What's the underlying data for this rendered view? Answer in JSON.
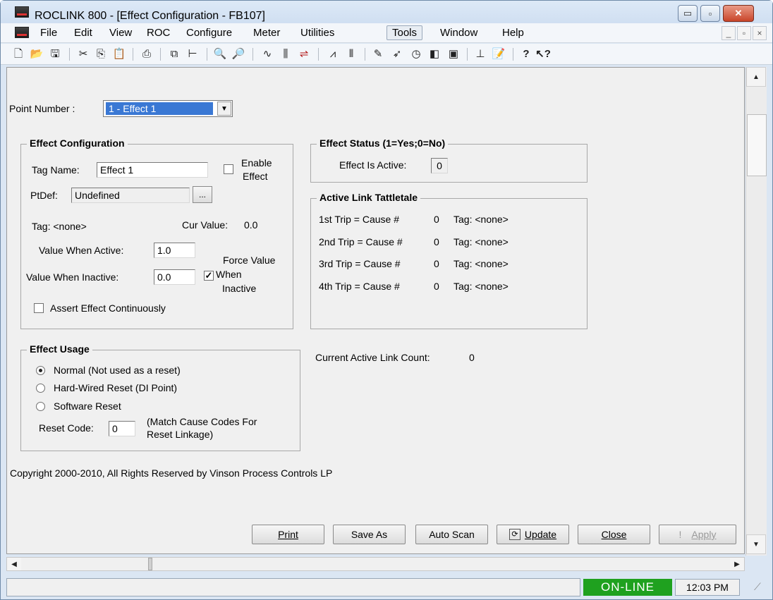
{
  "window": {
    "title": "ROCLINK 800 - [Effect Configuration - FB107]",
    "controls": {
      "minimize": "▭",
      "maximize": "▫",
      "close": "✕"
    }
  },
  "menu": {
    "items": [
      "File",
      "Edit",
      "View",
      "ROC",
      "Configure",
      "Meter",
      "Utilities",
      "Tools",
      "Window",
      "Help"
    ],
    "active": "Tools",
    "mdi_controls": [
      "_",
      "▫",
      "×"
    ]
  },
  "toolbar": {
    "icons": [
      "new-icon",
      "open-icon",
      "save-icon",
      "cut-icon",
      "copy-icon",
      "paste-icon",
      "print-icon",
      "connect-icon",
      "tree-icon",
      "zoom-in-icon",
      "zoom-out-icon",
      "trend-icon",
      "bars-icon",
      "link-icon",
      "wave-icon",
      "signal-icon",
      "flash-icon",
      "direct-icon",
      "clock-icon",
      "display-icon",
      "display2-icon",
      "chart-icon",
      "report-icon",
      "help-icon",
      "context-help-icon"
    ]
  },
  "form": {
    "point_number_label": "Point Number :",
    "point_number_value": "1 - Effect 1",
    "effect_config": {
      "title": "Effect Configuration",
      "tag_name_label": "Tag Name:",
      "tag_name_value": "Effect 1",
      "enable_effect_label_1": "Enable",
      "enable_effect_label_2": "Effect",
      "ptdef_label": "PtDef:",
      "ptdef_value": "Undefined",
      "ellipsis": "...",
      "tag_text": "Tag: <none>",
      "cur_value_label": "Cur Value:",
      "cur_value": "0.0",
      "value_active_label": "Value When Active:",
      "value_active": "1.0",
      "value_inactive_label": "Value When Inactive:",
      "value_inactive": "0.0",
      "force_value_1": "Force Value",
      "force_value_2": "When",
      "force_value_3": "Inactive",
      "assert_label": "Assert Effect Continuously"
    },
    "effect_status": {
      "title": "Effect Status (1=Yes;0=No)",
      "active_label": "Effect Is Active:",
      "active_value": "0"
    },
    "tattletale": {
      "title": "Active Link Tattletale",
      "trips": [
        {
          "label": "1st Trip = Cause #",
          "cause": "0",
          "tag": "Tag: <none>"
        },
        {
          "label": "2nd Trip = Cause #",
          "cause": "0",
          "tag": "Tag: <none>"
        },
        {
          "label": "3rd Trip = Cause #",
          "cause": "0",
          "tag": "Tag: <none>"
        },
        {
          "label": "4th Trip = Cause #",
          "cause": "0",
          "tag": "Tag: <none>"
        }
      ]
    },
    "effect_usage": {
      "title": "Effect Usage",
      "options": [
        "Normal (Not used as a reset)",
        "Hard-Wired Reset (DI Point)",
        "Software Reset"
      ],
      "selected": "Normal (Not used as a reset)",
      "reset_code_label": "Reset Code:",
      "reset_code": "0",
      "match_note_1": "(Match Cause Codes For",
      "match_note_2": "Reset Linkage)"
    },
    "active_link_count_label": "Current Active Link Count:",
    "active_link_count": "0",
    "copyright": "Copyright 2000-2010, All Rights Reserved by Vinson Process Controls LP"
  },
  "buttons": {
    "print": "Print",
    "save_as": "Save As",
    "auto_scan": "Auto Scan",
    "update": "Update",
    "close": "Close",
    "apply": "Apply"
  },
  "status": {
    "online": "ON-LINE",
    "time": "12:03 PM"
  }
}
